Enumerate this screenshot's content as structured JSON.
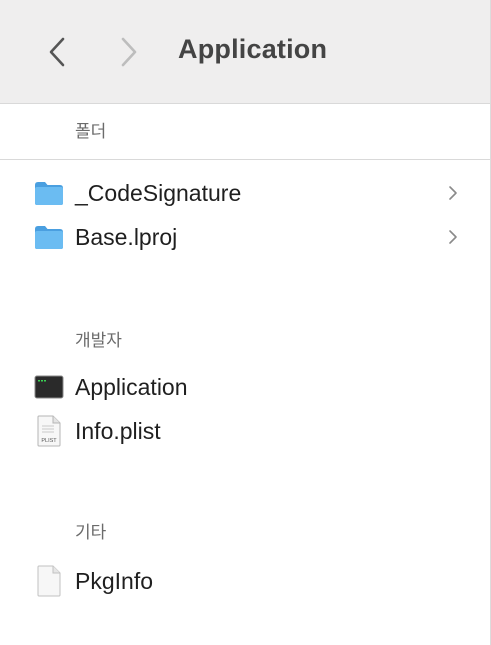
{
  "toolbar": {
    "title": "Application",
    "back_icon": "chevron-left-icon",
    "forward_icon": "chevron-right-icon"
  },
  "sections": [
    {
      "header": "폴더",
      "items": [
        {
          "label": "_CodeSignature",
          "icon": "folder-icon",
          "has_disclosure": true
        },
        {
          "label": "Base.lproj",
          "icon": "folder-icon",
          "has_disclosure": true
        }
      ]
    },
    {
      "header": "개발자",
      "items": [
        {
          "label": "Application",
          "icon": "terminal-executable-icon",
          "has_disclosure": false
        },
        {
          "label": "Info.plist",
          "icon": "plist-file-icon",
          "icon_text": "PLIST",
          "has_disclosure": false
        }
      ]
    },
    {
      "header": "기타",
      "items": [
        {
          "label": "PkgInfo",
          "icon": "generic-file-icon",
          "has_disclosure": false
        }
      ]
    }
  ],
  "colors": {
    "folder_blue": "#5aaeea",
    "toolbar_bg": "#efeeee",
    "section_text": "#6b6b6b"
  }
}
